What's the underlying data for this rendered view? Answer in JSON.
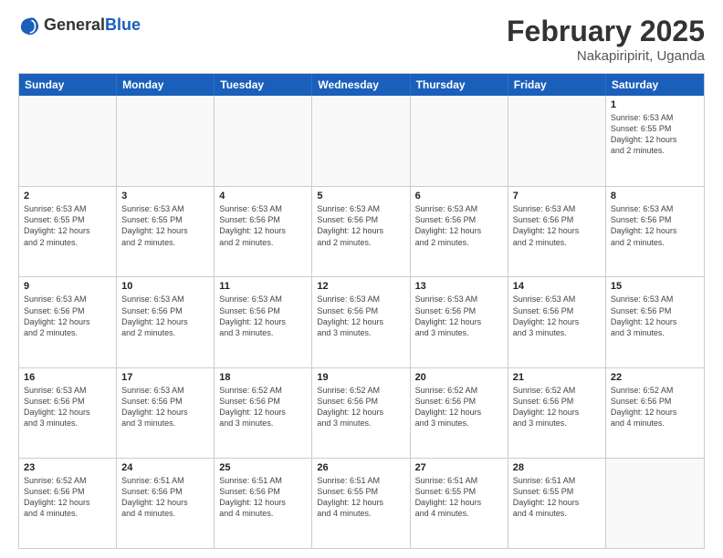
{
  "header": {
    "logo_general": "General",
    "logo_blue": "Blue",
    "month_year": "February 2025",
    "location": "Nakapiripirit, Uganda"
  },
  "weekdays": [
    "Sunday",
    "Monday",
    "Tuesday",
    "Wednesday",
    "Thursday",
    "Friday",
    "Saturday"
  ],
  "weeks": [
    [
      {
        "day": "",
        "info": ""
      },
      {
        "day": "",
        "info": ""
      },
      {
        "day": "",
        "info": ""
      },
      {
        "day": "",
        "info": ""
      },
      {
        "day": "",
        "info": ""
      },
      {
        "day": "",
        "info": ""
      },
      {
        "day": "1",
        "info": "Sunrise: 6:53 AM\nSunset: 6:55 PM\nDaylight: 12 hours\nand 2 minutes."
      }
    ],
    [
      {
        "day": "2",
        "info": "Sunrise: 6:53 AM\nSunset: 6:55 PM\nDaylight: 12 hours\nand 2 minutes."
      },
      {
        "day": "3",
        "info": "Sunrise: 6:53 AM\nSunset: 6:55 PM\nDaylight: 12 hours\nand 2 minutes."
      },
      {
        "day": "4",
        "info": "Sunrise: 6:53 AM\nSunset: 6:56 PM\nDaylight: 12 hours\nand 2 minutes."
      },
      {
        "day": "5",
        "info": "Sunrise: 6:53 AM\nSunset: 6:56 PM\nDaylight: 12 hours\nand 2 minutes."
      },
      {
        "day": "6",
        "info": "Sunrise: 6:53 AM\nSunset: 6:56 PM\nDaylight: 12 hours\nand 2 minutes."
      },
      {
        "day": "7",
        "info": "Sunrise: 6:53 AM\nSunset: 6:56 PM\nDaylight: 12 hours\nand 2 minutes."
      },
      {
        "day": "8",
        "info": "Sunrise: 6:53 AM\nSunset: 6:56 PM\nDaylight: 12 hours\nand 2 minutes."
      }
    ],
    [
      {
        "day": "9",
        "info": "Sunrise: 6:53 AM\nSunset: 6:56 PM\nDaylight: 12 hours\nand 2 minutes."
      },
      {
        "day": "10",
        "info": "Sunrise: 6:53 AM\nSunset: 6:56 PM\nDaylight: 12 hours\nand 2 minutes."
      },
      {
        "day": "11",
        "info": "Sunrise: 6:53 AM\nSunset: 6:56 PM\nDaylight: 12 hours\nand 3 minutes."
      },
      {
        "day": "12",
        "info": "Sunrise: 6:53 AM\nSunset: 6:56 PM\nDaylight: 12 hours\nand 3 minutes."
      },
      {
        "day": "13",
        "info": "Sunrise: 6:53 AM\nSunset: 6:56 PM\nDaylight: 12 hours\nand 3 minutes."
      },
      {
        "day": "14",
        "info": "Sunrise: 6:53 AM\nSunset: 6:56 PM\nDaylight: 12 hours\nand 3 minutes."
      },
      {
        "day": "15",
        "info": "Sunrise: 6:53 AM\nSunset: 6:56 PM\nDaylight: 12 hours\nand 3 minutes."
      }
    ],
    [
      {
        "day": "16",
        "info": "Sunrise: 6:53 AM\nSunset: 6:56 PM\nDaylight: 12 hours\nand 3 minutes."
      },
      {
        "day": "17",
        "info": "Sunrise: 6:53 AM\nSunset: 6:56 PM\nDaylight: 12 hours\nand 3 minutes."
      },
      {
        "day": "18",
        "info": "Sunrise: 6:52 AM\nSunset: 6:56 PM\nDaylight: 12 hours\nand 3 minutes."
      },
      {
        "day": "19",
        "info": "Sunrise: 6:52 AM\nSunset: 6:56 PM\nDaylight: 12 hours\nand 3 minutes."
      },
      {
        "day": "20",
        "info": "Sunrise: 6:52 AM\nSunset: 6:56 PM\nDaylight: 12 hours\nand 3 minutes."
      },
      {
        "day": "21",
        "info": "Sunrise: 6:52 AM\nSunset: 6:56 PM\nDaylight: 12 hours\nand 3 minutes."
      },
      {
        "day": "22",
        "info": "Sunrise: 6:52 AM\nSunset: 6:56 PM\nDaylight: 12 hours\nand 4 minutes."
      }
    ],
    [
      {
        "day": "23",
        "info": "Sunrise: 6:52 AM\nSunset: 6:56 PM\nDaylight: 12 hours\nand 4 minutes."
      },
      {
        "day": "24",
        "info": "Sunrise: 6:51 AM\nSunset: 6:56 PM\nDaylight: 12 hours\nand 4 minutes."
      },
      {
        "day": "25",
        "info": "Sunrise: 6:51 AM\nSunset: 6:56 PM\nDaylight: 12 hours\nand 4 minutes."
      },
      {
        "day": "26",
        "info": "Sunrise: 6:51 AM\nSunset: 6:55 PM\nDaylight: 12 hours\nand 4 minutes."
      },
      {
        "day": "27",
        "info": "Sunrise: 6:51 AM\nSunset: 6:55 PM\nDaylight: 12 hours\nand 4 minutes."
      },
      {
        "day": "28",
        "info": "Sunrise: 6:51 AM\nSunset: 6:55 PM\nDaylight: 12 hours\nand 4 minutes."
      },
      {
        "day": "",
        "info": ""
      }
    ]
  ]
}
